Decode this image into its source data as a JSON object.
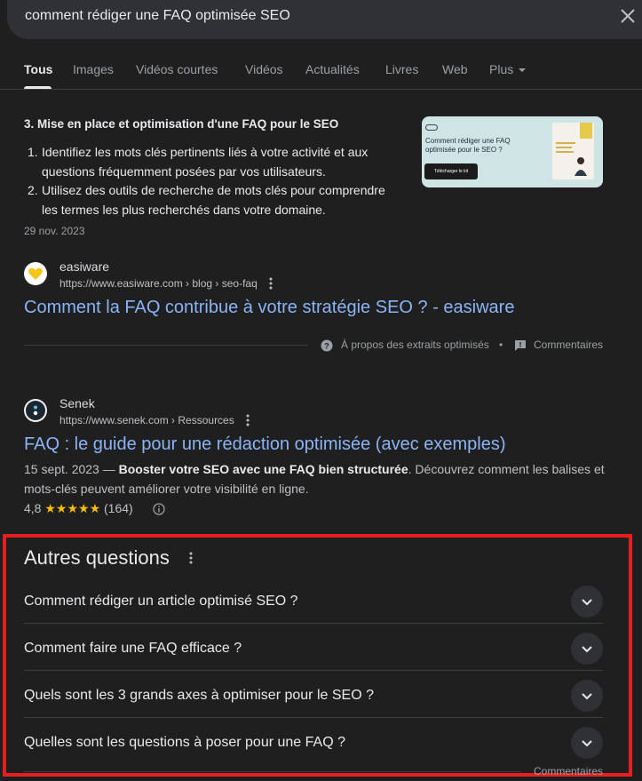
{
  "search": {
    "query": "comment rédiger une FAQ optimisée SEO"
  },
  "tabs": [
    {
      "label": "Tous"
    },
    {
      "label": "Images"
    },
    {
      "label": "Vidéos courtes"
    },
    {
      "label": "Vidéos"
    },
    {
      "label": "Actualités"
    },
    {
      "label": "Livres"
    },
    {
      "label": "Web"
    },
    {
      "label": "Plus"
    }
  ],
  "featured_snippet": {
    "heading": "3. Mise en place et optimisation d'une FAQ pour le SEO",
    "items": [
      {
        "num": "1.",
        "text": "Identifiez les mots clés pertinents liés à votre activité et aux questions fréquemment posées par vos utilisateurs."
      },
      {
        "num": "2.",
        "text": "Utilisez des outils de recherche de mots clés pour comprendre les termes les plus recherchés dans votre domaine."
      }
    ],
    "date": "29 nov. 2023",
    "thumbnail": {
      "title": "Comment rédiger une FAQ optimisée pour le SEO ?",
      "button": "Télécharger le kit"
    }
  },
  "results": [
    {
      "site_name": "easiware",
      "url": "https://www.easiware.com › blog › seo-faq",
      "title": "Comment la FAQ contribue à votre stratégie SEO ? - easiware",
      "logo_color": "#f5c518"
    },
    {
      "site_name": "Senek",
      "url": "https://www.senek.com › Ressources",
      "title": "FAQ : le guide pour une rédaction optimisée (avec exemples)",
      "snippet_date": "15 sept. 2023 — ",
      "snippet_bold": "Booster votre SEO avec une FAQ bien structurée",
      "snippet_rest": ". Découvrez comment les balises et mots-clés peuvent améliorer votre visibilité en ligne.",
      "rating_value": "4,8",
      "rating_stars": "★★★★★",
      "rating_count": "(164)"
    }
  ],
  "about_row": {
    "about_label": "À propos des extraits optimisés",
    "separator": "•",
    "feedback_label": "Commentaires"
  },
  "paa": {
    "title": "Autres questions",
    "questions": [
      "Comment rédiger un article optimisé SEO ?",
      "Comment faire une FAQ efficace ?",
      "Quels sont les 3 grands axes à optimiser pour le SEO ?",
      "Quelles sont les questions à poser pour une FAQ ?"
    ],
    "feedback_label": "Commentaires"
  },
  "colors": {
    "background": "#1f1f1f",
    "link": "#8ab4f8",
    "highlight_box": "#e51f1f",
    "stars": "#fbbc04"
  }
}
